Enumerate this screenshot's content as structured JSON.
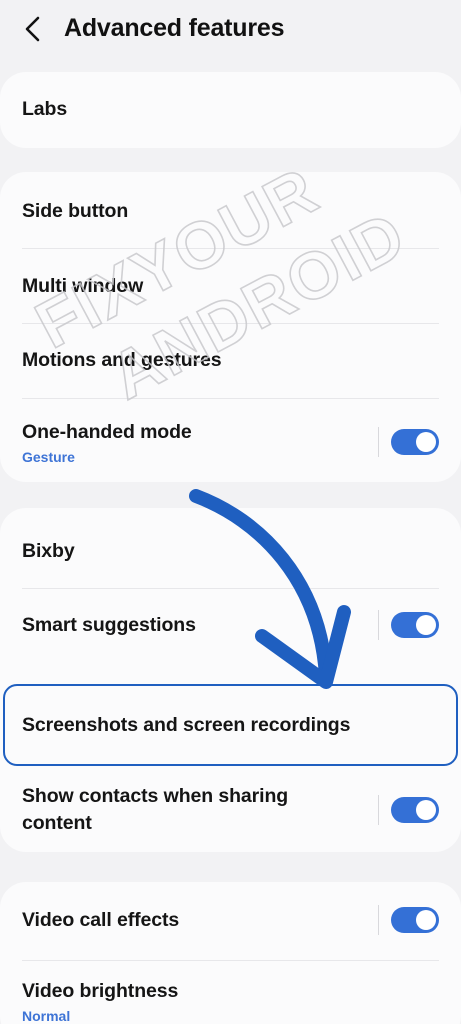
{
  "header": {
    "title": "Advanced features",
    "back_icon": "chevron-left-icon"
  },
  "sections": [
    {
      "items": [
        {
          "label": "Labs"
        }
      ]
    },
    {
      "items": [
        {
          "label": "Side button"
        },
        {
          "label": "Multi window"
        },
        {
          "label": "Motions and gestures"
        },
        {
          "label": "One-handed mode",
          "sublabel": "Gesture",
          "toggle": true
        }
      ]
    },
    {
      "items": [
        {
          "label": "Bixby"
        },
        {
          "label": "Smart suggestions",
          "toggle": true
        },
        {
          "label": "Screenshots and screen recordings",
          "highlighted": true
        },
        {
          "label": "Show contacts when sharing content",
          "toggle": true
        }
      ]
    },
    {
      "items": [
        {
          "label": "Video call effects",
          "toggle": true
        },
        {
          "label": "Video brightness",
          "sublabel": "Normal"
        }
      ]
    }
  ],
  "watermark": {
    "line1": "FIXYOUR",
    "line2": "ANDROID"
  },
  "colors": {
    "accent": "#3470d6",
    "sublabel": "#3e74d6",
    "background": "#f2f2f4",
    "card": "#fbfbfc",
    "annotation_arrow": "#1f5fc0"
  }
}
